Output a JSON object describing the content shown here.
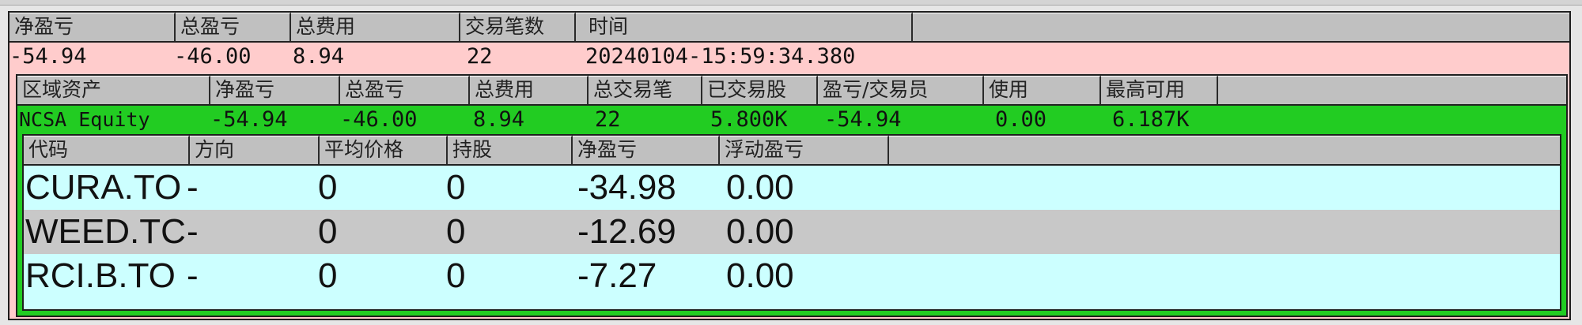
{
  "summary": {
    "headers": [
      "净盈亏",
      "总盈亏",
      "总费用",
      "交易笔数",
      "时间"
    ],
    "values": [
      "-54.94",
      "-46.00",
      "8.94",
      "22",
      "20240104-15:59:34.380"
    ]
  },
  "accounts": {
    "headers": [
      "区域资产",
      "净盈亏",
      "总盈亏",
      "总费用",
      "总交易笔",
      "已交易股",
      "盈亏/交易员",
      "使用",
      "最高可用"
    ],
    "row": [
      "NCSA Equity",
      "-54.94",
      "-46.00",
      "8.94",
      "22",
      "5.800K",
      "-54.94",
      "0.00",
      "6.187K"
    ]
  },
  "positions": {
    "headers": [
      "代码",
      "方向",
      "平均价格",
      "持股",
      "净盈亏",
      "浮动盈亏"
    ],
    "rows": [
      [
        "CURA.TO",
        "-",
        "0",
        "0",
        "-34.98",
        "0.00"
      ],
      [
        "WEED.TC",
        "-",
        "0",
        "0",
        "-12.69",
        "0.00"
      ],
      [
        "RCI.B.TO",
        "-",
        "0",
        "0",
        "-7.27",
        "0.00"
      ]
    ]
  },
  "colors": {
    "summary_bg": "#ffcccc",
    "account_bg": "#22cc22",
    "position_row_cyan": "#ccffff",
    "position_row_gray": "#c8c8c8",
    "header_gray": "#c0c0c0"
  }
}
